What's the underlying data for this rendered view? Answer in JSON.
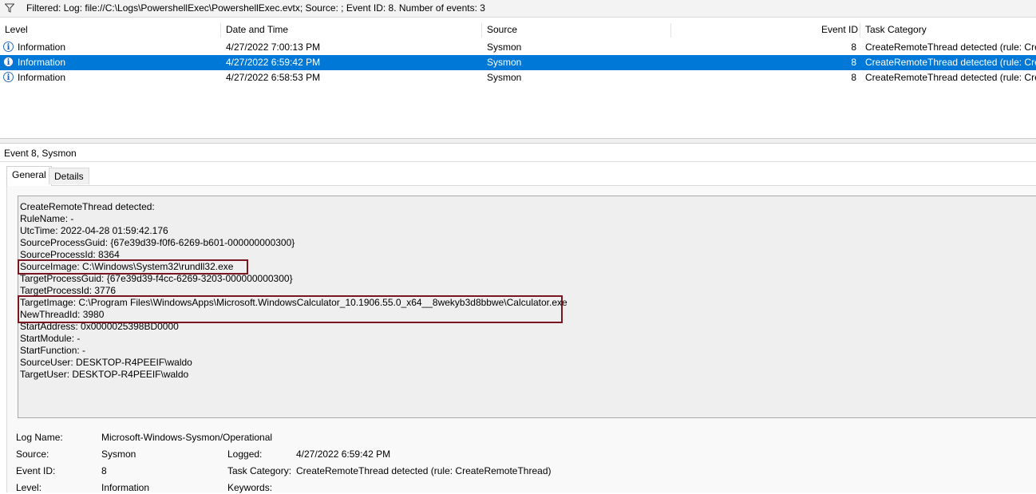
{
  "filter": {
    "text": "Filtered: Log: file://C:\\Logs\\PowershellExec\\PowershellExec.evtx; Source: ; Event ID: 8. Number of events: 3"
  },
  "columns": {
    "level": "Level",
    "datetime": "Date and Time",
    "source": "Source",
    "eventid": "Event ID",
    "category": "Task Category"
  },
  "rows": [
    {
      "level": "Information",
      "datetime": "4/27/2022 7:00:13 PM",
      "source": "Sysmon",
      "eventid": "8",
      "category": "CreateRemoteThread detected (rule: Cre...",
      "selected": false
    },
    {
      "level": "Information",
      "datetime": "4/27/2022 6:59:42 PM",
      "source": "Sysmon",
      "eventid": "8",
      "category": "CreateRemoteThread detected (rule: Cre...",
      "selected": true
    },
    {
      "level": "Information",
      "datetime": "4/27/2022 6:58:53 PM",
      "source": "Sysmon",
      "eventid": "8",
      "category": "CreateRemoteThread detected (rule: Cre...",
      "selected": false
    }
  ],
  "detail": {
    "header": "Event 8, Sysmon",
    "tabs": {
      "general": "General",
      "details": "Details"
    },
    "message_lines": [
      "CreateRemoteThread detected:",
      "RuleName: -",
      "UtcTime: 2022-04-28 01:59:42.176",
      "SourceProcessGuid: {67e39d39-f0f6-6269-b601-000000000300}",
      "SourceProcessId: 8364",
      "SourceImage: C:\\Windows\\System32\\rundll32.exe",
      "TargetProcessGuid: {67e39d39-f4cc-6269-3203-000000000300}",
      "TargetProcessId: 3776",
      "TargetImage: C:\\Program Files\\WindowsApps\\Microsoft.WindowsCalculator_10.1906.55.0_x64__8wekyb3d8bbwe\\Calculator.exe",
      "NewThreadId: 3980",
      "StartAddress: 0x0000025398BD0000",
      "StartModule: -",
      "StartFunction: -",
      "SourceUser: DESKTOP-R4PEEIF\\waldo",
      "TargetUser: DESKTOP-R4PEEIF\\waldo"
    ],
    "props": {
      "log_name_label": "Log Name:",
      "log_name_value": "Microsoft-Windows-Sysmon/Operational",
      "source_label": "Source:",
      "source_value": "Sysmon",
      "logged_label": "Logged:",
      "logged_value": "4/27/2022 6:59:42 PM",
      "event_id_label": "Event ID:",
      "event_id_value": "8",
      "task_category_label": "Task Category:",
      "task_category_value": "CreateRemoteThread detected (rule: CreateRemoteThread)",
      "level_label": "Level:",
      "level_value": "Information",
      "keywords_label": "Keywords:"
    }
  },
  "colors": {
    "selection": "#0078d7",
    "highlight_box": "#7a1620"
  }
}
